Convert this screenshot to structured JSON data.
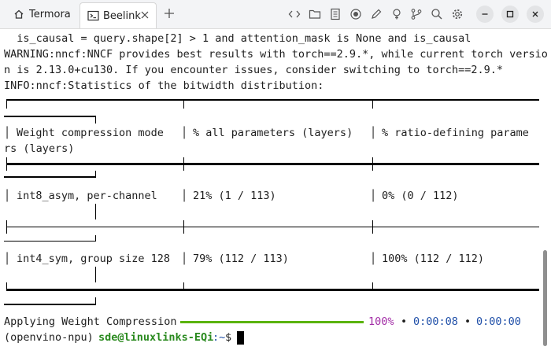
{
  "window": {
    "tabs": [
      {
        "label": "Termora",
        "active": false,
        "icon": "home-icon"
      },
      {
        "label": "Beelink",
        "active": true,
        "icon": "terminal-icon"
      }
    ],
    "toolbar_icons": [
      "code-icon",
      "folder-icon",
      "document-icon",
      "record-icon",
      "pen-icon",
      "bulb-icon",
      "branch-icon",
      "search-icon",
      "gear-icon"
    ],
    "controls": [
      "minimize-icon",
      "maximize-icon",
      "close-icon"
    ]
  },
  "terminal": {
    "output_lines": [
      "  is_causal = query.shape[2] > 1 and attention_mask is None and is_causal",
      "WARNING:nncf:NNCF provides best results with torch==2.9.*, while current torch versio",
      "n is 2.13.0+cu130. If you encounter issues, consider switching to torch==2.9.*",
      "INFO:nncf:Statistics of the bitwidth distribution:"
    ],
    "table": {
      "headers": [
        "Weight compression mode",
        "% all parameters (layers)",
        "% ratio-defining parame"
      ],
      "header_wrap": "rs (layers)",
      "rows": [
        [
          "int8_asym, per-channel",
          "21% (1 / 113)",
          "0% (0 / 112)"
        ],
        [
          "int4_sym, group size 128",
          "79% (112 / 113)",
          "100% (112 / 112)"
        ]
      ]
    },
    "progress": {
      "label": "Applying Weight Compression",
      "percent_text": "100%",
      "fraction": 1.0,
      "bullet": "•",
      "elapsed": "0:00:08",
      "remaining": "0:00:00"
    },
    "prompt": {
      "env": "(openvino-npu)",
      "user_host": "sde@linuxlinks-EQi",
      "path": ":~",
      "symbol": "$"
    },
    "colors": {
      "progress_bar": "#5ab30e",
      "percent": "#a22ca6",
      "time": "#1f4fa8",
      "prompt_user": "#2a8a1f"
    }
  }
}
